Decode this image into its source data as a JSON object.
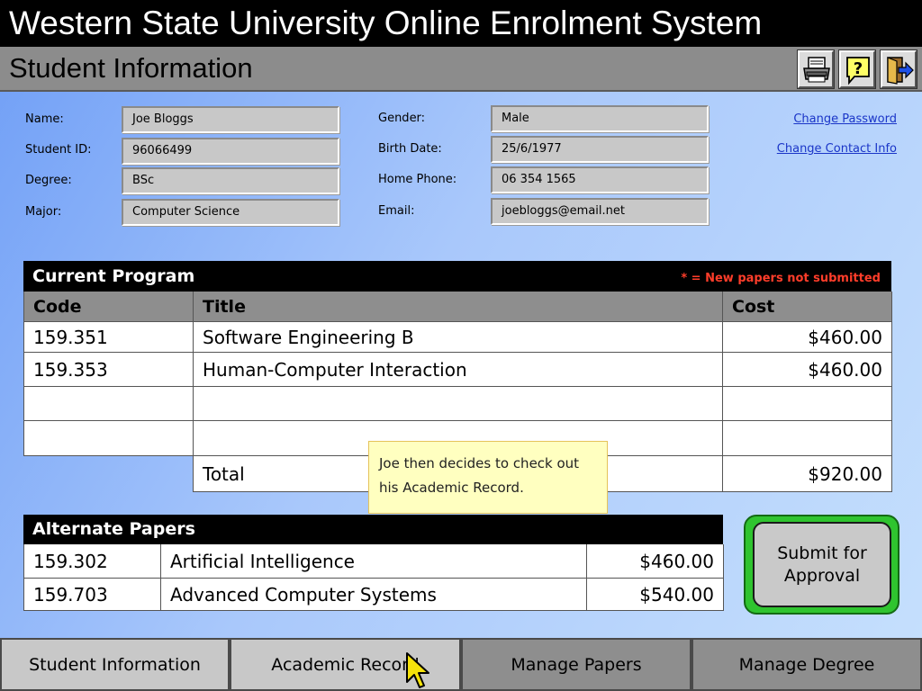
{
  "app": {
    "title": "Western State University Online Enrolment System"
  },
  "page": {
    "title": "Student Information"
  },
  "toolbar": [
    {
      "name": "print-icon"
    },
    {
      "name": "help-icon"
    },
    {
      "name": "exit-icon"
    }
  ],
  "student": {
    "name_label": "Name:",
    "name": "Joe Bloggs",
    "id_label": "Student ID:",
    "id": "96066499",
    "degree_label": "Degree:",
    "degree": "BSc",
    "major_label": "Major:",
    "major": "Computer Science",
    "gender_label": "Gender:",
    "gender": "Male",
    "birth_label": "Birth Date:",
    "birth": "25/6/1977",
    "phone_label": "Home Phone:",
    "phone": "06 354 1565",
    "email_label": "Email:",
    "email": "joebloggs@email.net"
  },
  "links": {
    "change_password": "Change Password",
    "change_contact": "Change Contact Info"
  },
  "program": {
    "title": "Current Program",
    "note": "* = New papers not submitted",
    "headers": {
      "code": "Code",
      "title": "Title",
      "cost": "Cost"
    },
    "rows": [
      {
        "code": "159.351",
        "title": "Software Engineering B",
        "cost": "$460.00"
      },
      {
        "code": "159.353",
        "title": "Human-Computer Interaction",
        "cost": "$460.00"
      },
      {
        "code": "",
        "title": "",
        "cost": ""
      },
      {
        "code": "",
        "title": "",
        "cost": ""
      }
    ],
    "total_label": "Total",
    "total": "$920.00"
  },
  "alternate": {
    "title": "Alternate Papers",
    "rows": [
      {
        "code": "159.302",
        "title": "Artificial Intelligence",
        "cost": "$460.00"
      },
      {
        "code": "159.703",
        "title": "Advanced Computer Systems",
        "cost": "$540.00"
      }
    ]
  },
  "tooltip": "Joe then decides to check out his Academic Record.",
  "submit_label": "Submit for Approval",
  "tabs": [
    {
      "label": "Student Information"
    },
    {
      "label": "Academic Record"
    },
    {
      "label": "Manage Papers"
    },
    {
      "label": "Manage Degree"
    }
  ]
}
